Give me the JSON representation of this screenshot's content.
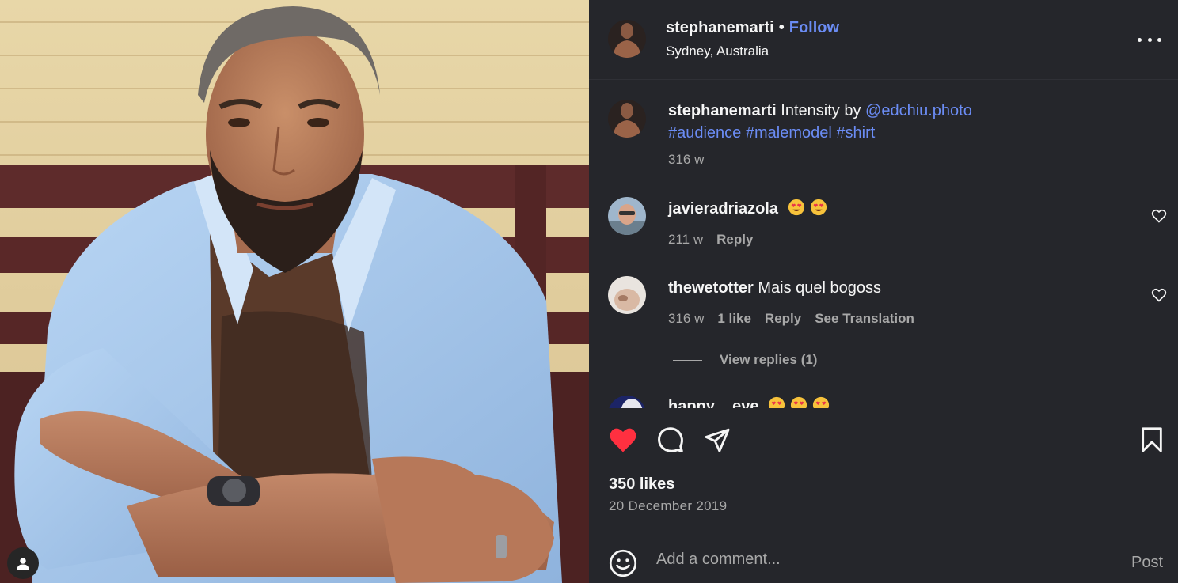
{
  "header": {
    "username": "stephanemarti",
    "separator": "•",
    "follow_label": "Follow",
    "location": "Sydney, Australia",
    "more_icon": "more-horizontal-icon"
  },
  "caption": {
    "username": "stephanemarti",
    "text": "Intensity by",
    "mention": "@edchiu.photo",
    "hashtags": [
      "#audience",
      "#malemodel",
      "#shirt"
    ],
    "time": "316 w"
  },
  "comments": [
    {
      "username": "javieradriazola",
      "text": "😍😍",
      "time": "211 w",
      "reply_label": "Reply"
    },
    {
      "username": "thewetotter",
      "text": "Mais quel bogoss",
      "time": "316 w",
      "likes_label": "1 like",
      "reply_label": "Reply",
      "translate_label": "See Translation"
    },
    {
      "username": "happy__eve",
      "text": "😍😍😍"
    }
  ],
  "view_replies_label": "View replies (1)",
  "actions": {
    "like_icon": "heart-filled-icon",
    "comment_icon": "comment-icon",
    "share_icon": "paper-plane-icon",
    "save_icon": "bookmark-icon",
    "like_color": "#ff3040"
  },
  "likes_text": "350 likes",
  "date_text": "20 December 2019",
  "add_comment": {
    "placeholder": "Add a comment...",
    "post_label": "Post"
  },
  "theme": {
    "panel_bg": "#25262b",
    "link_color": "#6b8cf4",
    "muted": "#a8a8a8"
  }
}
